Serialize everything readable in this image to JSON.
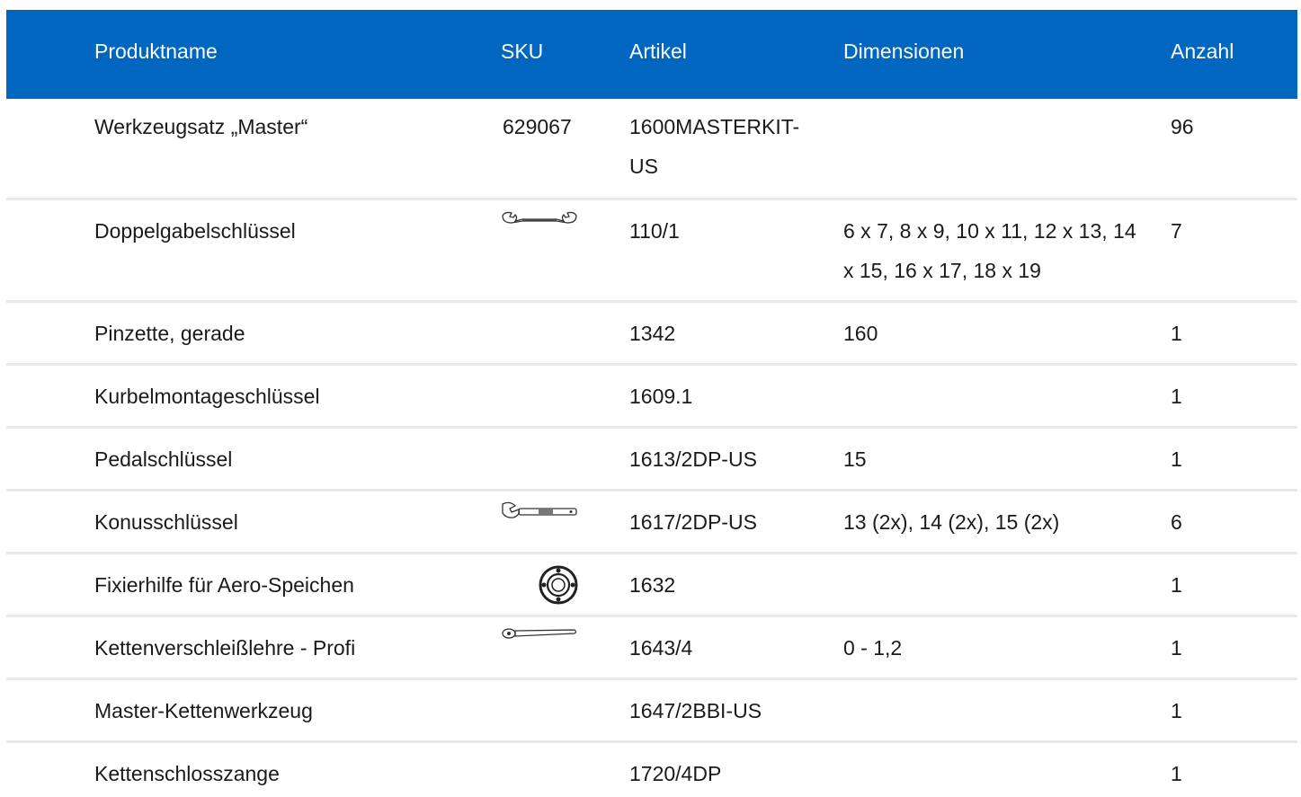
{
  "header": {
    "name": "Produktname",
    "sku": "SKU",
    "artikel": "Artikel",
    "dimensionen": "Dimensionen",
    "anzahl": "Anzahl"
  },
  "rows": [
    {
      "name": "Werkzeugsatz „Master“",
      "sku": "629067",
      "artikel": "1600MASTERKIT-US",
      "dimensionen": "",
      "anzahl": "96",
      "icon": ""
    },
    {
      "name": "Doppelgabelschlüssel",
      "sku": "",
      "artikel": "110/1",
      "dimensionen": "6 x 7, 8 x 9, 10 x 11, 12 x 13, 14 x 15, 16 x 17, 18 x 19",
      "anzahl": "7",
      "icon": "double-open-end-wrench-icon"
    },
    {
      "name": "Pinzette, gerade",
      "sku": "",
      "artikel": "1342",
      "dimensionen": "160",
      "anzahl": "1",
      "icon": ""
    },
    {
      "name": "Kurbelmontageschlüssel",
      "sku": "",
      "artikel": "1609.1",
      "dimensionen": "",
      "anzahl": "1",
      "icon": ""
    },
    {
      "name": "Pedalschlüssel",
      "sku": "",
      "artikel": "1613/2DP-US",
      "dimensionen": "15",
      "anzahl": "1",
      "icon": ""
    },
    {
      "name": "Konusschlüssel",
      "sku": "",
      "artikel": "1617/2DP-US",
      "dimensionen": "13 (2x), 14 (2x), 15 (2x)",
      "anzahl": "6",
      "icon": "cone-wrench-icon"
    },
    {
      "name": "Fixierhilfe für Aero-Speichen",
      "sku": "",
      "artikel": "1632",
      "dimensionen": "",
      "anzahl": "1",
      "icon": "aero-spoke-holder-icon"
    },
    {
      "name": "Kettenverschleißlehre - Profi",
      "sku": "",
      "artikel": "1643/4",
      "dimensionen": "0 - 1,2",
      "anzahl": "1",
      "icon": "chain-wear-gauge-icon"
    },
    {
      "name": "Master-Kettenwerkzeug",
      "sku": "",
      "artikel": "1647/2BBI-US",
      "dimensionen": "",
      "anzahl": "1",
      "icon": ""
    },
    {
      "name": "Kettenschlosszange",
      "sku": "",
      "artikel": "1720/4DP",
      "dimensionen": "",
      "anzahl": "1",
      "icon": ""
    }
  ]
}
